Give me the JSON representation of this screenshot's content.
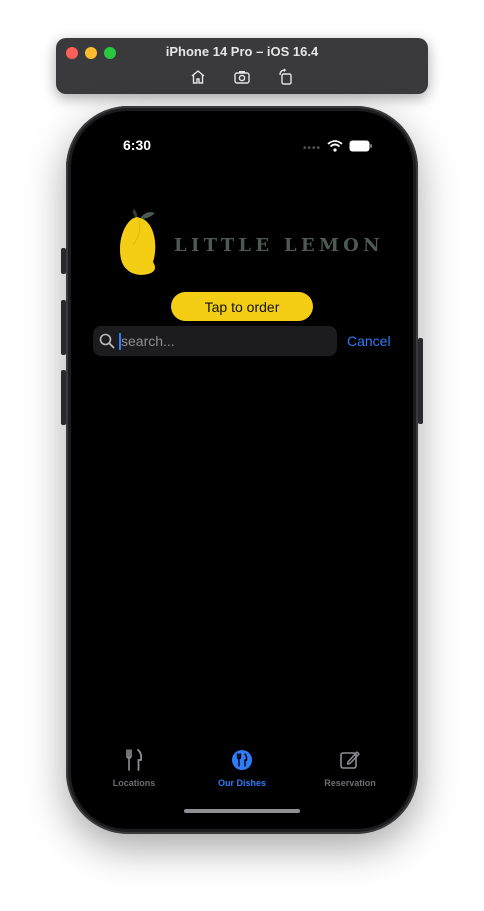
{
  "simulator": {
    "title": "iPhone 14 Pro – iOS 16.4",
    "tools": [
      {
        "icon": "home-icon"
      },
      {
        "icon": "screenshot-icon"
      },
      {
        "icon": "rotate-icon"
      }
    ]
  },
  "status_bar": {
    "time": "6:30",
    "icons": [
      "signal-dots-icon",
      "wifi-icon",
      "battery-icon"
    ]
  },
  "header": {
    "logo_text": "LITTLE LEMON",
    "logo_icon": "lemon-icon",
    "order_button": "Tap to order"
  },
  "search": {
    "placeholder": "search...",
    "value": "",
    "cancel_label": "Cancel"
  },
  "tabs": [
    {
      "label": "Locations",
      "icon": "fork-knife-icon",
      "active": false
    },
    {
      "label": "Our Dishes",
      "icon": "dishes-icon",
      "active": true
    },
    {
      "label": "Reservation",
      "icon": "square-pencil-icon",
      "active": false
    }
  ],
  "colors": {
    "accent": "#2f7cf6",
    "order_button": "#f4ce14",
    "background": "#000000",
    "logo_text": "#4b5a53"
  }
}
